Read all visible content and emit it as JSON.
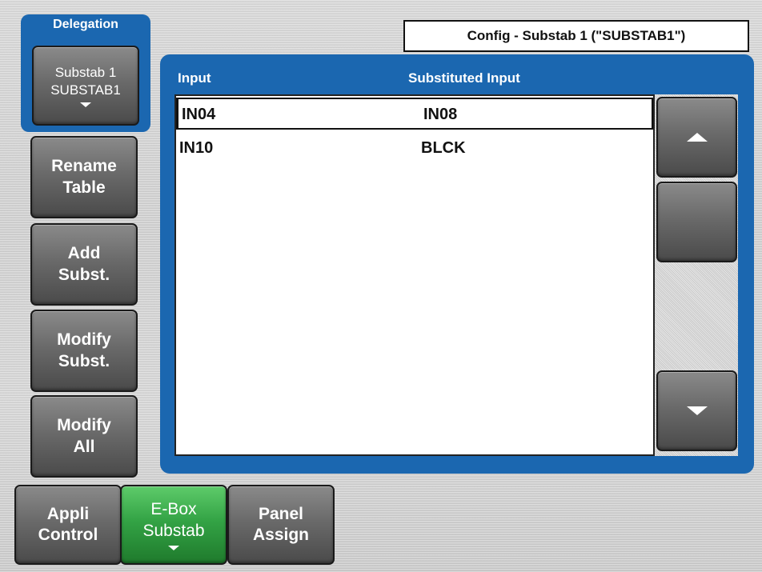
{
  "delegation": {
    "title": "Delegation",
    "button_line1": "Substab 1",
    "button_line2": "SUBSTAB1"
  },
  "side_buttons": {
    "rename": [
      "Rename",
      "Table"
    ],
    "add": [
      "Add",
      "Subst."
    ],
    "modify": [
      "Modify",
      "Subst."
    ],
    "modify_all": [
      "Modify",
      "All"
    ]
  },
  "config_title": "Config - Substab 1 (\"SUBSTAB1\")",
  "table": {
    "columns": [
      "Input",
      "Substituted Input"
    ],
    "rows": [
      {
        "input": "IN04",
        "substituted": "IN08",
        "selected": true
      },
      {
        "input": "IN10",
        "substituted": "BLCK",
        "selected": false
      }
    ]
  },
  "bottom_tabs": {
    "appli": [
      "Appli",
      "Control"
    ],
    "ebox": [
      "E-Box",
      "Substab"
    ],
    "panel": [
      "Panel",
      "Assign"
    ]
  },
  "colors": {
    "panel_blue": "#1b67b0",
    "active_tab_green": "#33a345"
  },
  "icons": [
    "chevron-up-icon",
    "chevron-down-icon"
  ]
}
